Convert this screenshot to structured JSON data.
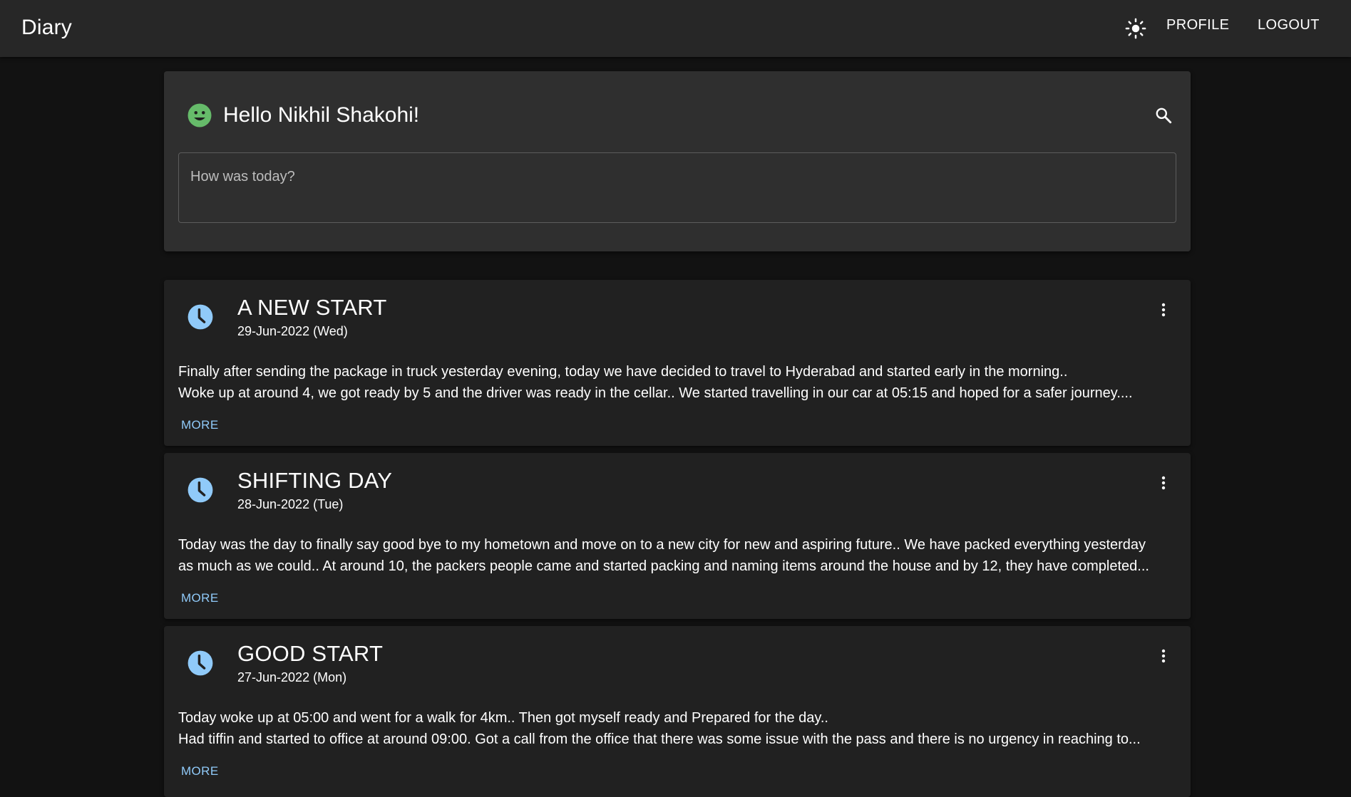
{
  "app": {
    "title": "Diary"
  },
  "header": {
    "theme_icon": "sun-icon",
    "profile_label": "PROFILE",
    "logout_label": "LOGOUT"
  },
  "composer": {
    "greeting": "Hello Nikhil Shakohi!",
    "greeting_icon": "smiley-icon",
    "search_icon": "search-icon",
    "input_placeholder": "How was today?",
    "input_value": ""
  },
  "colors": {
    "background": "#121212",
    "appbar": "#272727",
    "card": "#212121",
    "composer": "#2f2f2f",
    "accent_blue": "#90caf9",
    "accent_green": "#66bb6a"
  },
  "entries": [
    {
      "title": "A NEW START",
      "date": "29-Jun-2022 (Wed)",
      "lines": [
        "Finally after sending the package in truck yesterday evening, today we have decided to travel to Hyderabad and started early in the morning..",
        "Woke up at around 4, we got ready by 5 and the driver was ready in the cellar.. We started travelling in our car at 05:15 and hoped for a safer journey...."
      ],
      "more_label": "MORE"
    },
    {
      "title": "SHIFTING DAY",
      "date": "28-Jun-2022 (Tue)",
      "lines": [
        "Today was the day to finally say good bye to my hometown and move on to a new city for new and aspiring future.. We have packed everything yesterday",
        "as much as we could.. At around 10, the packers people came and started packing and naming items around the house and by 12, they have completed..."
      ],
      "more_label": "MORE"
    },
    {
      "title": "GOOD START",
      "date": "27-Jun-2022 (Mon)",
      "lines": [
        "Today woke up at 05:00 and went for a walk for 4km.. Then got myself ready and Prepared for the day..",
        "Had tiffin and started to office at around 09:00. Got a call from the office that there was some issue with the pass and there is no urgency in reaching to..."
      ],
      "more_label": "MORE"
    }
  ]
}
